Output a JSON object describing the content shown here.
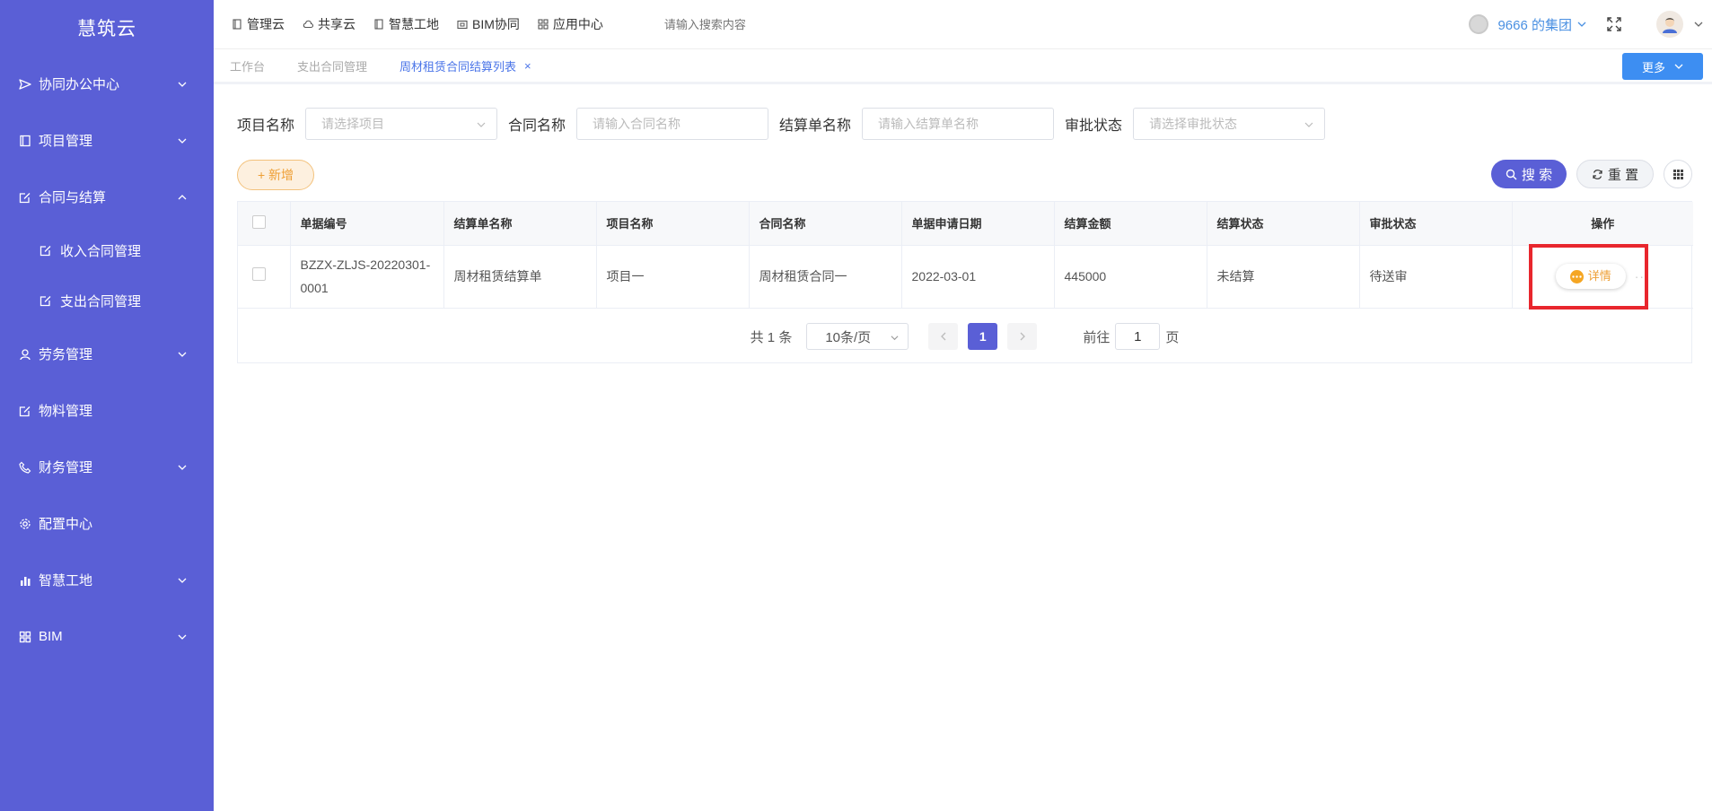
{
  "sidebar": {
    "brand": "慧筑云",
    "items": [
      {
        "label": "协同办公中心",
        "icon": "send-icon",
        "expandable": true
      },
      {
        "label": "项目管理",
        "icon": "book-icon",
        "expandable": true
      },
      {
        "label": "合同与结算",
        "icon": "edit-icon",
        "expandable": true,
        "expanded": true
      },
      {
        "label": "劳务管理",
        "icon": "worker-icon",
        "expandable": true
      },
      {
        "label": "物料管理",
        "icon": "edit-icon",
        "expandable": false
      },
      {
        "label": "财务管理",
        "icon": "phone-icon",
        "expandable": true
      },
      {
        "label": "配置中心",
        "icon": "gear-icon",
        "expandable": false
      },
      {
        "label": "智慧工地",
        "icon": "bar-chart-icon",
        "expandable": true
      },
      {
        "label": "BIM",
        "icon": "grid-icon",
        "expandable": true
      }
    ],
    "subitems": [
      {
        "label": "收入合同管理"
      },
      {
        "label": "支出合同管理"
      }
    ]
  },
  "topnav": {
    "items": [
      {
        "label": "管理云"
      },
      {
        "label": "共享云"
      },
      {
        "label": "智慧工地"
      },
      {
        "label": "BIM协同"
      },
      {
        "label": "应用中心"
      }
    ],
    "search_placeholder": "请输入搜索内容",
    "org_name": "9666 的集团"
  },
  "tabs": {
    "items": [
      {
        "label": "工作台"
      },
      {
        "label": "支出合同管理"
      },
      {
        "label": "周材租赁合同结算列表",
        "close": "×"
      }
    ],
    "more_label": "更多"
  },
  "filters": {
    "project": {
      "label": "项目名称",
      "placeholder": "请选择项目"
    },
    "contract": {
      "label": "合同名称",
      "placeholder": "请输入合同名称"
    },
    "settlement": {
      "label": "结算单名称",
      "placeholder": "请输入结算单名称"
    },
    "approval": {
      "label": "审批状态",
      "placeholder": "请选择审批状态"
    }
  },
  "actions": {
    "add_label": "+ 新增",
    "search_label": "搜 索",
    "reset_label": "重 置"
  },
  "table": {
    "columns": [
      "单据编号",
      "结算单名称",
      "项目名称",
      "合同名称",
      "单据申请日期",
      "结算金额",
      "结算状态",
      "审批状态",
      "操作"
    ],
    "rows": [
      {
        "code": "BZZX-ZLJS-20220301-0001",
        "settlement_name": "周材租赁结算单",
        "project": "项目一",
        "contract": "周材租赁合同一",
        "date": "2022-03-01",
        "amount": "445000",
        "settle_status": "未结算",
        "approval_status": "待送审",
        "detail_label": "详情",
        "more_label": "···"
      }
    ]
  },
  "pagination": {
    "total": "共 1 条",
    "page_size": "10条/页",
    "current": "1",
    "goto_prefix": "前往",
    "goto_value": "1",
    "goto_suffix": "页"
  },
  "colors": {
    "sidebar": "#5a5fd6",
    "accent_orange": "#ee9f35",
    "primary_blue": "#3d8ef2",
    "highlight_red": "#e8262d"
  }
}
